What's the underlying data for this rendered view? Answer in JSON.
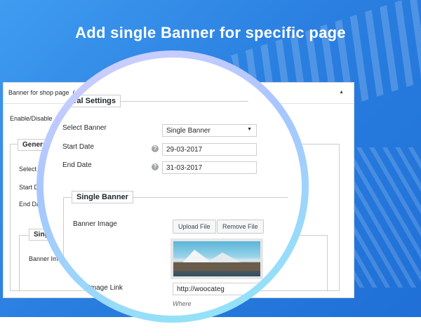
{
  "headline": "Add single Banner for specific page",
  "panel": {
    "title": "Banner for shop page",
    "title_suffix": "( En",
    "enable_label": "Enable/Disable",
    "general_legend": "General",
    "general_fields_truncated": [
      "Select Ba",
      "Start Dat",
      "End Date"
    ],
    "single_legend_truncated": "Single",
    "banner_image_truncated": "Banner Imag"
  },
  "lens": {
    "general_settings_legend": "eral Settings",
    "select_banner_label": "Select Banner",
    "select_banner_value": "Single Banner",
    "start_date_label": "Start Date",
    "start_date_value": "29-03-2017",
    "end_date_label": "End Date",
    "end_date_value": "31-03-2017",
    "help_glyph": "?",
    "single_banner_legend": "Single Banner",
    "banner_image_label": "Banner Image",
    "upload_button": "Upload File",
    "remove_button": "Remove File",
    "image_link_label": "Image Link",
    "image_link_value": "http://woocateg",
    "image_link_desc": "Where"
  },
  "colors": {
    "hero": "#2a7fe0",
    "ring_start": "#d7d0ff",
    "ring_end": "#8fe8f6"
  }
}
